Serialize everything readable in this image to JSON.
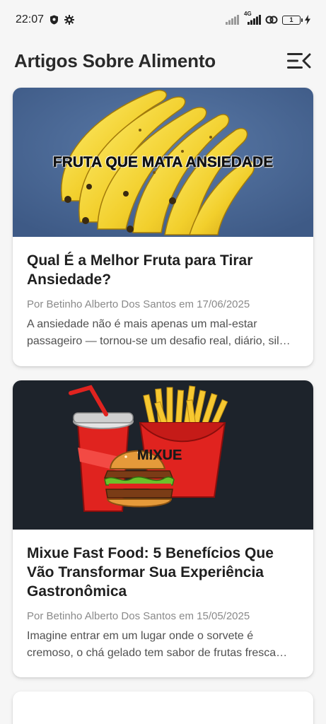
{
  "status_bar": {
    "time": "22:07",
    "network": "4G",
    "battery": "1"
  },
  "header": {
    "title": "Artigos Sobre Alimento"
  },
  "articles": [
    {
      "image_caption": "FRUTA QUE MATA ANSIEDADE",
      "title": "Qual É a Melhor Fruta para Tirar Ansiedade?",
      "meta": "Por Betinho Alberto Dos Santos em 17/06/2025",
      "excerpt": "A ansiedade não é mais apenas um mal-estar passageiro — tornou-se um desafio real, diário, sil…"
    },
    {
      "image_caption": "MIXUE",
      "title": "Mixue Fast Food: 5 Benefícios Que Vão Transformar Sua Experiência Gastronômica",
      "meta": "Por Betinho Alberto Dos Santos em 15/05/2025",
      "excerpt": "Imagine entrar em um lugar onde o sorvete é cremoso, o chá gelado tem sabor de frutas fresca…"
    }
  ],
  "colors": {
    "background": "#f6f6f6",
    "card": "#ffffff",
    "banana_bg": "#4b6a9b",
    "fastfood_bg": "#1d232b"
  }
}
